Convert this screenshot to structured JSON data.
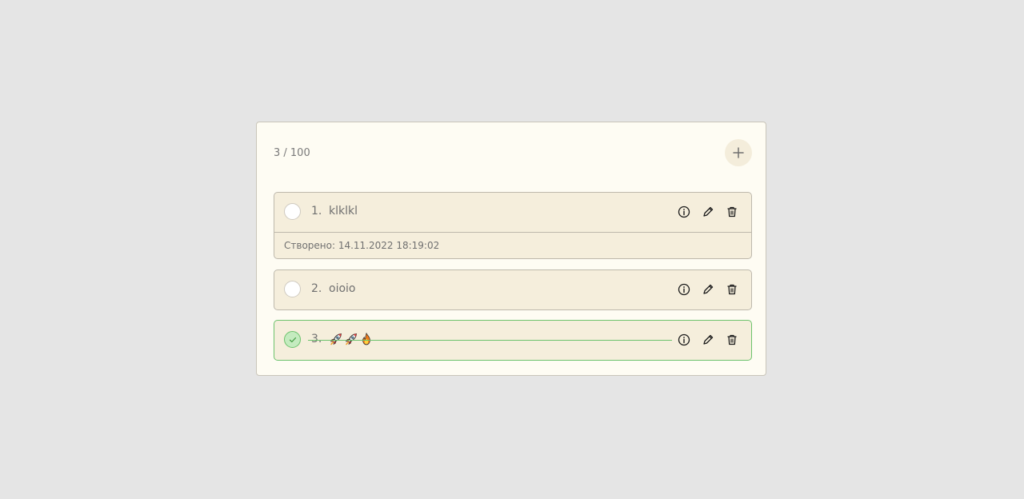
{
  "header": {
    "counter": "3 / 100",
    "add_icon": "plus-icon"
  },
  "todos": [
    {
      "number": "1.",
      "title": "klklkl",
      "done": false,
      "expanded": true,
      "created": "Створено: 14.11.2022 18:19:02"
    },
    {
      "number": "2.",
      "title": "oioio",
      "done": false,
      "expanded": false
    },
    {
      "number": "3.",
      "title_emojis": [
        "rocket",
        "rocket",
        "fire"
      ],
      "done": true,
      "expanded": false
    }
  ],
  "icons": {
    "info": "info-icon",
    "edit": "pencil-icon",
    "delete": "trash-icon",
    "check": "check-icon"
  },
  "colors": {
    "page_bg": "#e5e5e5",
    "card_bg": "#fefcf3",
    "item_bg": "#f5eedc",
    "done_accent": "#6cc26c"
  }
}
